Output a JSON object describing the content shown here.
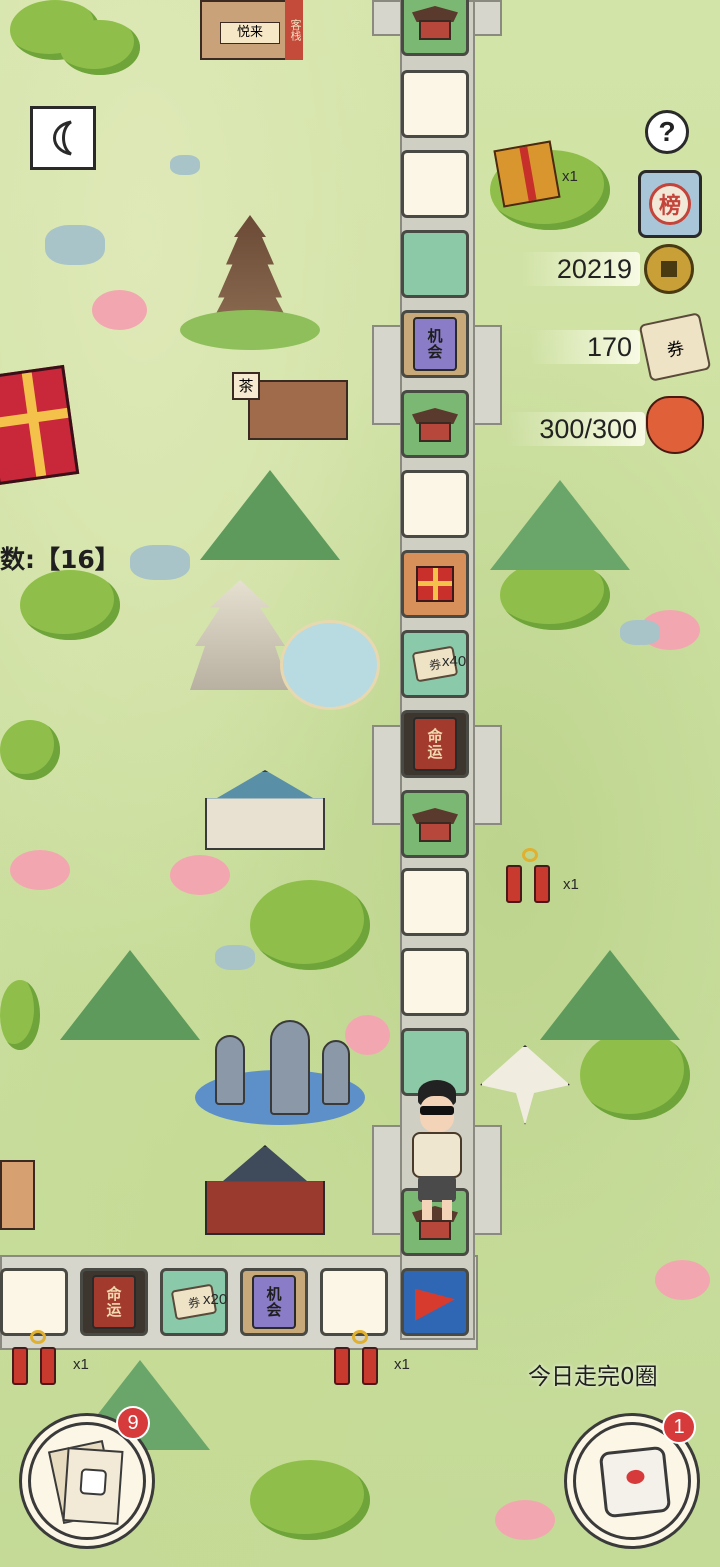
{
  "hud": {
    "help_glyph": "?",
    "rank_glyph": "榜",
    "coins": "20219",
    "tickets": "170",
    "energy": "300/300",
    "gift_count": "x1",
    "back_icon": "back-arrow-icon"
  },
  "left_panel": {
    "steps_label": "数:【16】"
  },
  "path": {
    "chance_text": [
      "机",
      "会"
    ],
    "fate_text": [
      "命",
      "运"
    ],
    "ticket_glyph": "券",
    "ticket_x40": "x40",
    "ticket_x20": "x20",
    "bottom_ticket_x20": "x20"
  },
  "rewards": {
    "firecracker_right": "x1",
    "firecracker_bottom_left": "x1",
    "firecracker_bottom_mid": "x1"
  },
  "footer": {
    "laps_today": "今日走完0圈",
    "cards_badge": "9",
    "dice_badge": "1"
  },
  "scenery": {
    "tea_sign": "茶",
    "inn_sign": "悦来",
    "banner_text": "客栈"
  },
  "colors": {
    "tile_blank": "#fbf6e6",
    "tile_green": "#8cc9a6",
    "accent_red": "#d63a3a",
    "chance_purple": "#8b7cc7",
    "fate_red": "#a23b2d"
  }
}
